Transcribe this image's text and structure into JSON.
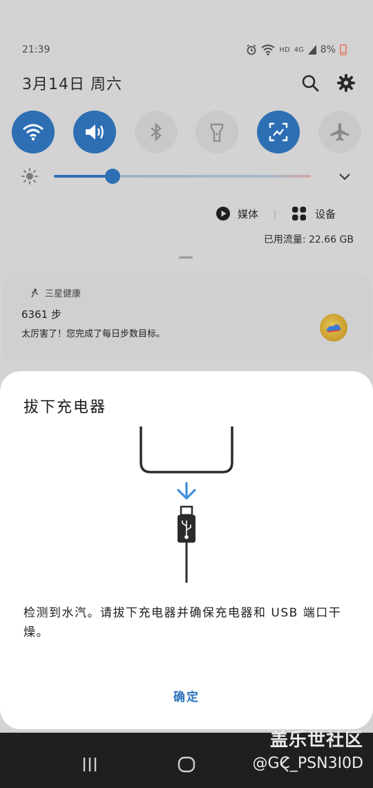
{
  "status_bar": {
    "time": "21:39",
    "network_label": "HD",
    "signal_label": "4G",
    "battery": "8%"
  },
  "shade": {
    "date": "3月14日 周六",
    "media_label": "媒体",
    "devices_label": "设备",
    "data_usage": "已用流量: 22.66 GB"
  },
  "notification": {
    "app": "三星健康",
    "title": "6361 步",
    "body": "太厉害了！您完成了每日步数目标。"
  },
  "dialog": {
    "title": "拔下充电器",
    "message": "检测到水汽。请拔下充电器并确保充电器和 USB 端口干燥。",
    "ok_label": "确定"
  },
  "watermark": {
    "line1": "盖乐世社区",
    "line2": "@GC_PSN3I0D"
  },
  "colors": {
    "accent": "#2e6fb3",
    "dialog_button": "#2b73bb",
    "arrow": "#3d8fdb"
  }
}
